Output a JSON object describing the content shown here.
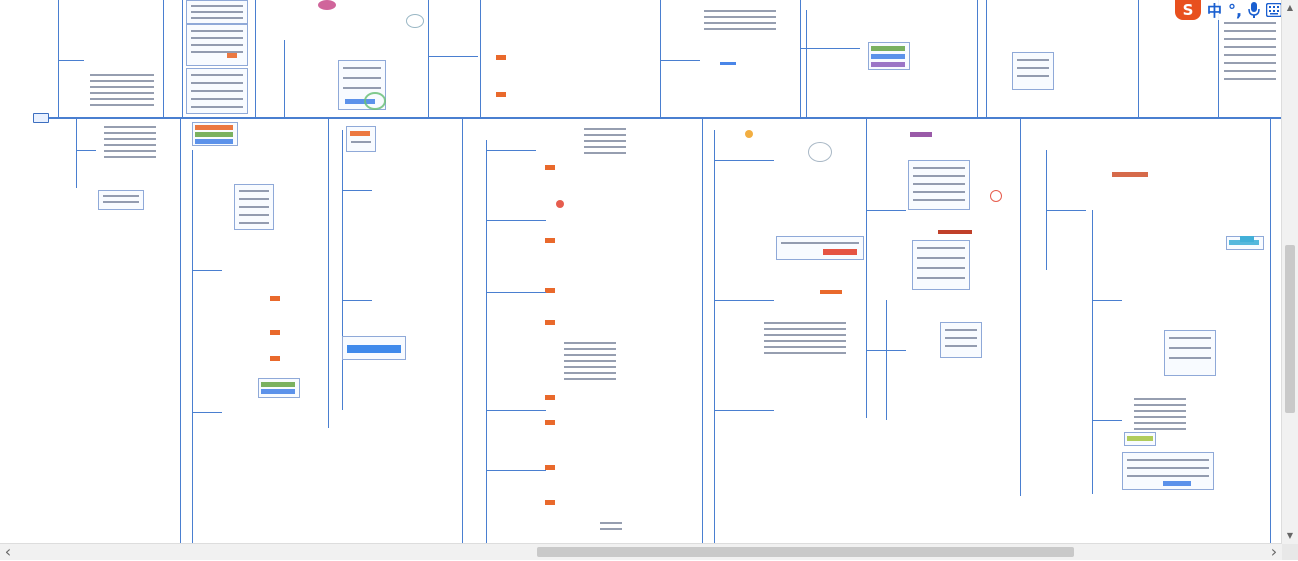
{
  "window": {
    "title": ""
  },
  "ime_bar": {
    "logo": "S",
    "mode_label": "中",
    "punct_label": "°,",
    "mic_icon": "microphone-icon",
    "keyboard_icon": "keyboard-icon"
  },
  "scrollbars": {
    "horizontal": {
      "left_arrow": "‹",
      "right_arrow": "›",
      "position": 0.5
    },
    "vertical": {
      "up_arrow": "▲",
      "down_arrow": "▼",
      "position": 0.55
    }
  },
  "colors": {
    "connector": "#4a7fd0",
    "ime_brand": "#e8501e",
    "ime_blue": "#1a5fd0"
  }
}
